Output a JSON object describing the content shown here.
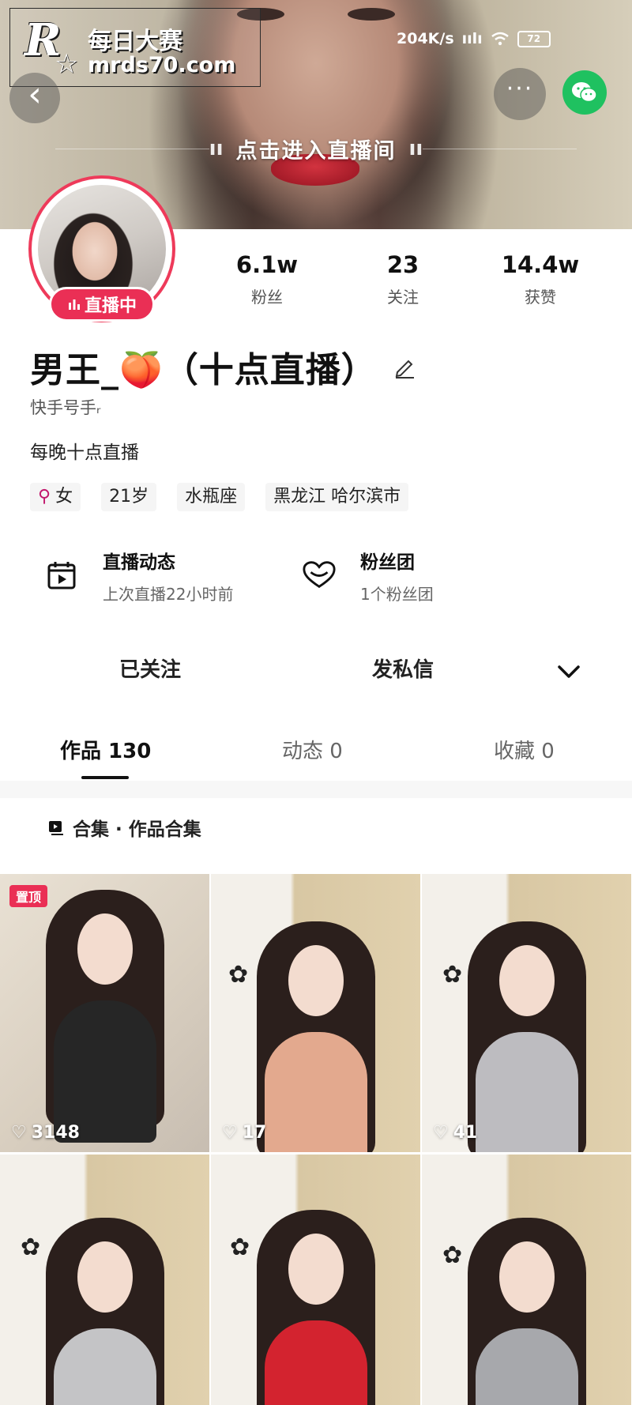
{
  "watermark": {
    "logo": "R",
    "star": "☆",
    "cn": "每日大赛",
    "url": "mrds70.com"
  },
  "status": {
    "speed": "204K/s",
    "battery": "72"
  },
  "banner": {
    "live_enter": "点击进入直播间"
  },
  "header": {
    "back_icon": "back-arrow-icon",
    "more_icon": "more-dots-icon",
    "share_icon": "wechat-icon"
  },
  "profile": {
    "live_badge": "直播中",
    "stats": [
      {
        "num": "6.1w",
        "label": "粉丝"
      },
      {
        "num": "23",
        "label": "关注"
      },
      {
        "num": "14.4w",
        "label": "获赞"
      }
    ],
    "name": "男王_🍑（十点直播）",
    "ks_id": "快手号手ᵣ",
    "bio": "每晚十点直播",
    "tags": {
      "gender": "女",
      "age": "21岁",
      "zodiac": "水瓶座",
      "location": "黑龙江 哈尔滨市"
    }
  },
  "cards": {
    "live": {
      "title": "直播动态",
      "sub": "上次直播22小时前"
    },
    "fans": {
      "title": "粉丝团",
      "sub": "1个粉丝团"
    }
  },
  "actions": {
    "follow": "已关注",
    "message": "发私信"
  },
  "tabs": [
    {
      "label": "作品 130"
    },
    {
      "label": "动态 0"
    },
    {
      "label": "收藏 0"
    }
  ],
  "collection": {
    "label": "合集 · 作品合集"
  },
  "grid": [
    {
      "pin": "置顶",
      "likes": "3148"
    },
    {
      "likes": "17"
    },
    {
      "likes": "41"
    },
    {
      "likes": ""
    },
    {
      "likes": ""
    },
    {
      "likes": ""
    }
  ],
  "colors": {
    "accent": "#ea2f55",
    "wechat": "#1fc160"
  }
}
